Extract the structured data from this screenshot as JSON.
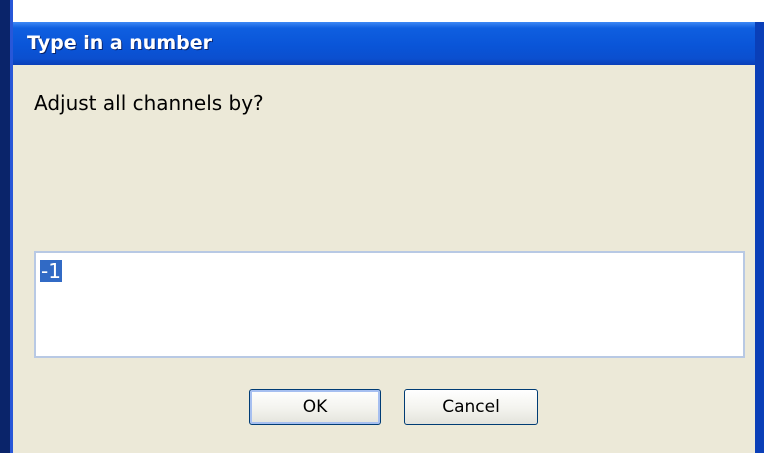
{
  "dialog": {
    "title": "Type in a number",
    "prompt": "Adjust all channels by?",
    "input_value": "-1",
    "ok_label": "OK",
    "cancel_label": "Cancel"
  },
  "colors": {
    "titlebar": "#0a55d8",
    "client_background": "#ece9d8",
    "selection": "#316ac5"
  }
}
